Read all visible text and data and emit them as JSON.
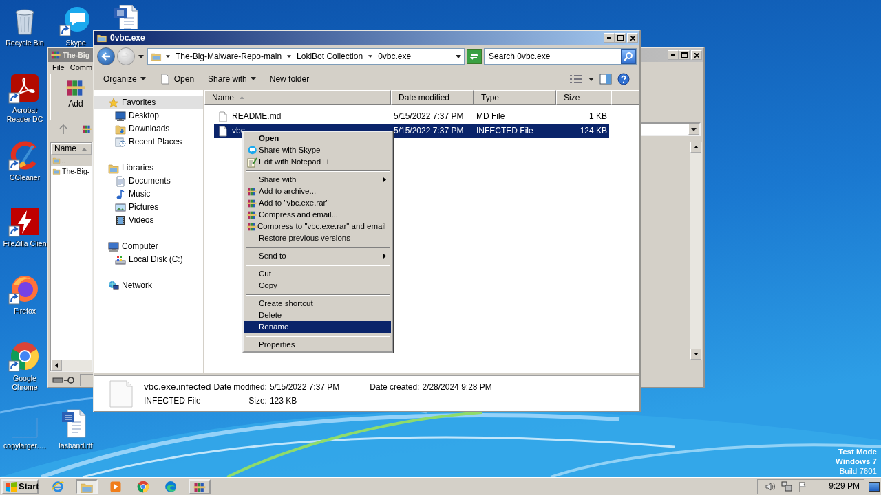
{
  "desktop": {
    "icons": [
      {
        "kind": "recycle-bin",
        "label": "Recycle Bin",
        "shortcut": false
      },
      {
        "kind": "skype",
        "label": "Skype",
        "shortcut": true
      },
      {
        "kind": "word-doc",
        "shortcut": false
      },
      {
        "kind": "acrobat",
        "label": "Acrobat Reader DC",
        "shortcut": true
      },
      {
        "kind": "ccleaner",
        "label": "CCleaner",
        "shortcut": true
      },
      {
        "kind": "filezilla",
        "label": "FileZilla Clien",
        "shortcut": true
      },
      {
        "kind": "firefox",
        "label": "Firefox",
        "shortcut": true
      },
      {
        "kind": "chrome",
        "label": "Google Chrome",
        "shortcut": true
      },
      {
        "kind": "blank",
        "label": "copylarger.…",
        "shortcut": false
      },
      {
        "kind": "word-doc",
        "label": "lasband.rtf",
        "shortcut": false
      }
    ],
    "system_text": [
      "Test Mode",
      "Windows 7",
      "Build 7601"
    ]
  },
  "archiver_window": {
    "title": "The-Big",
    "menu": [
      "File",
      "Comm"
    ],
    "toolbar": [
      {
        "label": "Add"
      }
    ],
    "columns": [
      {
        "label": "Name",
        "sorted": true
      }
    ],
    "rows": [
      {
        "name": "..",
        "selected": true
      },
      {
        "name": "The-Big-",
        "selected": false
      }
    ]
  },
  "explorer_window": {
    "title": "0vbc.exe",
    "breadcrumb": [
      "The-Big-Malware-Repo-main",
      "LokiBot Collection",
      "0vbc.exe"
    ],
    "search": {
      "placeholder": "Search 0vbc.exe"
    },
    "toolbar": [
      {
        "kind": "text",
        "label": "Organize",
        "dropdown": true
      },
      {
        "kind": "page",
        "label": "Open",
        "dropdown": false
      },
      {
        "kind": "text",
        "label": "Share with",
        "dropdown": true
      },
      {
        "kind": "text",
        "label": "New folder",
        "dropdown": false
      }
    ],
    "navigation": [
      {
        "kind": "star",
        "label": "Favorites",
        "selected": true,
        "children": [
          {
            "kind": "desktop",
            "label": "Desktop",
            "selected": false
          },
          {
            "kind": "downloads",
            "label": "Downloads",
            "selected": false
          },
          {
            "kind": "recent",
            "label": "Recent Places",
            "selected": false
          }
        ]
      },
      {
        "kind": "libraries",
        "label": "Libraries",
        "selected": false,
        "children": [
          {
            "kind": "documents",
            "label": "Documents",
            "selected": false
          },
          {
            "kind": "music",
            "label": "Music",
            "selected": false
          },
          {
            "kind": "pictures",
            "label": "Pictures",
            "selected": false
          },
          {
            "kind": "videos",
            "label": "Videos",
            "selected": false
          }
        ]
      },
      {
        "kind": "computer",
        "label": "Computer",
        "selected": false,
        "children": [
          {
            "kind": "disk",
            "label": "Local Disk (C:)",
            "selected": false
          }
        ]
      },
      {
        "kind": "network",
        "label": "Network",
        "selected": false
      }
    ],
    "columns": [
      {
        "label": "Name",
        "sorted": true
      },
      {
        "label": "Date modified",
        "sorted": false
      },
      {
        "label": "Type",
        "sorted": false
      },
      {
        "label": "Size",
        "sorted": false
      }
    ],
    "rows": [
      {
        "name": "README.md",
        "date": "5/15/2022 7:37 PM",
        "type": "MD File",
        "size": "1 KB",
        "selected": false
      },
      {
        "name": "vbc",
        "date": "5/15/2022 7:37 PM",
        "type": "INFECTED File",
        "size": "124 KB",
        "selected": true
      }
    ],
    "details": {
      "name": "vbc.exe.infected",
      "type": "INFECTED File",
      "fields": [
        {
          "label": "Date modified:",
          "value": "5/15/2022 7:37 PM"
        },
        {
          "label": "Date created:",
          "value": "2/28/2024 9:28 PM"
        },
        {
          "label": "Size:",
          "value": "123 KB"
        }
      ]
    }
  },
  "context_menu": [
    {
      "kind": "item",
      "label": "Open",
      "default": true,
      "submenu": false,
      "selected": false
    },
    {
      "kind": "skype",
      "label": "Share with Skype",
      "default": false,
      "submenu": false,
      "selected": false
    },
    {
      "kind": "notepad",
      "label": "Edit with Notepad++",
      "default": false,
      "submenu": false,
      "selected": false
    },
    {
      "kind": "separator"
    },
    {
      "kind": "item",
      "label": "Share with",
      "default": false,
      "submenu": true,
      "selected": false
    },
    {
      "kind": "winrar",
      "label": "Add to archive...",
      "default": false,
      "submenu": false,
      "selected": false
    },
    {
      "kind": "winrar",
      "label": "Add to \"vbc.exe.rar\"",
      "default": false,
      "submenu": false,
      "selected": false
    },
    {
      "kind": "winrar",
      "label": "Compress and email...",
      "default": false,
      "submenu": false,
      "selected": false
    },
    {
      "kind": "winrar",
      "label": "Compress to \"vbc.exe.rar\" and email",
      "default": false,
      "submenu": false,
      "selected": false
    },
    {
      "kind": "item",
      "label": "Restore previous versions",
      "default": false,
      "submenu": false,
      "selected": false
    },
    {
      "kind": "separator"
    },
    {
      "kind": "item",
      "label": "Send to",
      "default": false,
      "submenu": true,
      "selected": false
    },
    {
      "kind": "separator"
    },
    {
      "kind": "item",
      "label": "Cut",
      "default": false,
      "submenu": false,
      "selected": false
    },
    {
      "kind": "item",
      "label": "Copy",
      "default": false,
      "submenu": false,
      "selected": false
    },
    {
      "kind": "separator"
    },
    {
      "kind": "item",
      "label": "Create shortcut",
      "default": false,
      "submenu": false,
      "selected": false
    },
    {
      "kind": "item",
      "label": "Delete",
      "default": false,
      "submenu": false,
      "selected": false
    },
    {
      "kind": "item",
      "label": "Rename",
      "default": false,
      "submenu": false,
      "selected": true
    },
    {
      "kind": "separator"
    },
    {
      "kind": "item",
      "label": "Properties",
      "default": false,
      "submenu": false,
      "selected": false
    }
  ],
  "taskbar": {
    "start": "Start",
    "tasks": [
      {
        "kind": "ie",
        "running": false,
        "active": false
      },
      {
        "kind": "explorer",
        "running": true,
        "active": true
      },
      {
        "kind": "media",
        "running": false,
        "active": false
      },
      {
        "kind": "chrome",
        "running": false,
        "active": false
      },
      {
        "kind": "edge",
        "running": false,
        "active": false
      },
      {
        "kind": "winrar",
        "running": true,
        "active": false
      }
    ],
    "tray": [
      {
        "kind": "volume"
      },
      {
        "kind": "network"
      },
      {
        "kind": "flag"
      }
    ],
    "clock": "9:29 PM"
  }
}
